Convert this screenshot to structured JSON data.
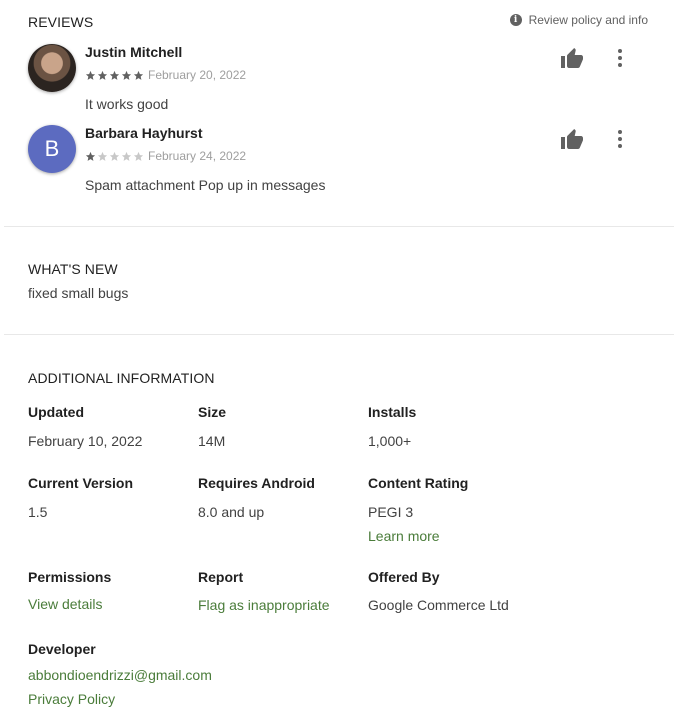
{
  "reviews": {
    "heading": "REVIEWS",
    "policy_link": "Review policy and info",
    "items": [
      {
        "name": "Justin Mitchell",
        "rating": 5,
        "date": "February 20, 2022",
        "text": "It works good",
        "avatar_type": "photo"
      },
      {
        "name": "Barbara Hayhurst",
        "rating": 1,
        "date": "February 24, 2022",
        "text": "Spam attachment Pop up in messages",
        "avatar_type": "letter",
        "avatar_letter": "B",
        "avatar_color": "#5c6bc0"
      }
    ]
  },
  "whats_new": {
    "heading": "WHAT'S NEW",
    "text": "fixed small bugs"
  },
  "additional_info": {
    "heading": "ADDITIONAL INFORMATION",
    "updated": {
      "label": "Updated",
      "value": "February 10, 2022"
    },
    "size": {
      "label": "Size",
      "value": "14M"
    },
    "installs": {
      "label": "Installs",
      "value": "1,000+"
    },
    "current_version": {
      "label": "Current Version",
      "value": "1.5"
    },
    "requires_android": {
      "label": "Requires Android",
      "value": "8.0 and up"
    },
    "content_rating": {
      "label": "Content Rating",
      "value": "PEGI 3",
      "link": "Learn more"
    },
    "permissions": {
      "label": "Permissions",
      "link": "View details"
    },
    "report": {
      "label": "Report",
      "link": "Flag as inappropriate"
    },
    "offered_by": {
      "label": "Offered By",
      "value": "Google Commerce Ltd"
    },
    "developer": {
      "label": "Developer",
      "email": "abbondioendrizzi@gmail.com",
      "privacy": "Privacy Policy"
    }
  },
  "colors": {
    "link": "#4a7c3a",
    "star_filled": "#616161",
    "star_empty": "#c8c8c8",
    "icon": "#616161"
  },
  "icons": [
    "info-icon",
    "star-icon",
    "thumbs-up-icon",
    "more-vert-icon"
  ]
}
